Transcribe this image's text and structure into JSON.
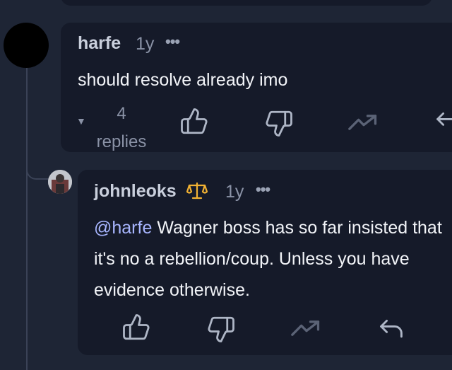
{
  "comments": [
    {
      "username": "harfe",
      "age": "1y",
      "more": "•••",
      "text": "should resolve already imo",
      "replies_count": "4",
      "replies_label": "replies"
    },
    {
      "username": "johnleoks",
      "age": "1y",
      "more": "•••",
      "mention": "@harfe",
      "text": "Wagner boss has so far insisted that it's no a rebellion/coup. Unless you have evidence otherwise."
    }
  ],
  "icons": {
    "like": "thumbs-up-icon",
    "dislike": "thumbs-down-icon",
    "trend": "trending-up-icon",
    "reply": "reply-arrow-icon",
    "badge": "scales-icon",
    "toggle": "caret-down-icon"
  },
  "colors": {
    "background": "#1e2535",
    "card": "#151a29",
    "mention": "#a8b6ff",
    "badge": "#f2b233"
  }
}
